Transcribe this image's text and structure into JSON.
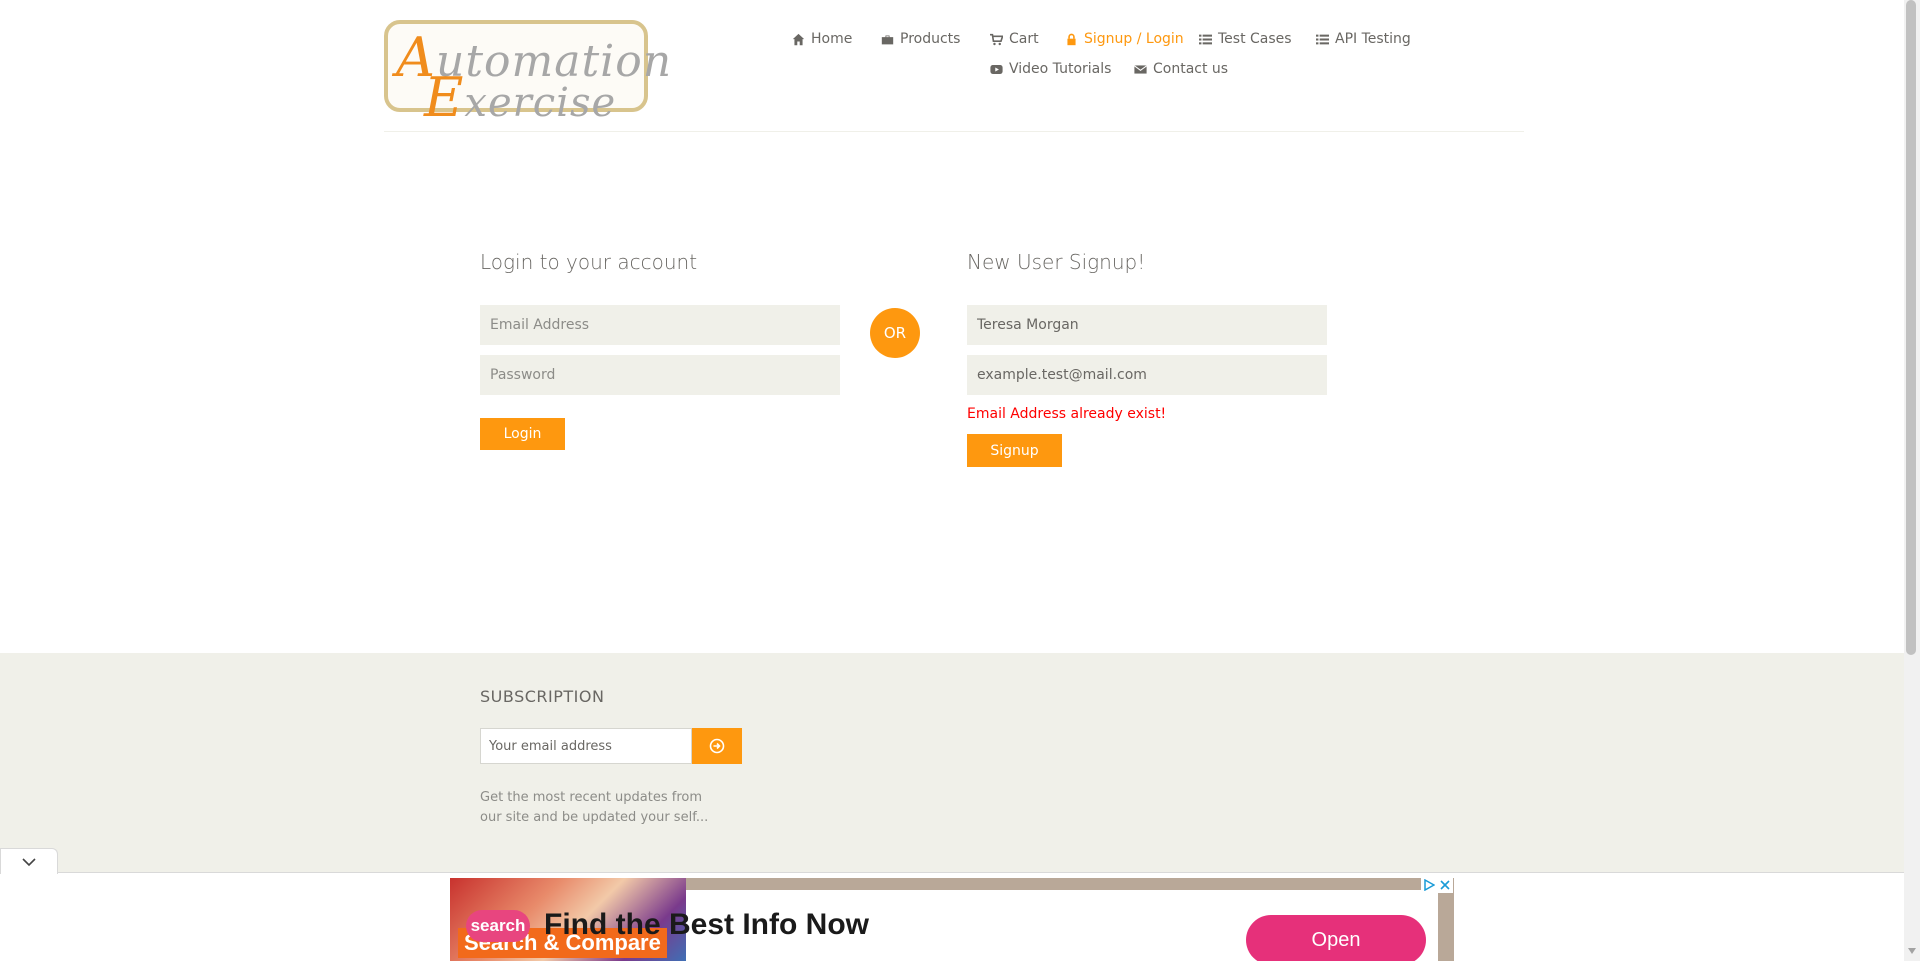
{
  "logo": {
    "line1": "utomation",
    "line1_cap": "A",
    "line2": "xercise",
    "line2_cap": "E"
  },
  "nav": [
    {
      "label": "Home",
      "icon": "home-icon"
    },
    {
      "label": "Products",
      "icon": "briefcase-icon"
    },
    {
      "label": "Cart",
      "icon": "cart-icon"
    },
    {
      "label": "Signup / Login",
      "icon": "lock-icon",
      "active": true
    },
    {
      "label": "Test Cases",
      "icon": "list-icon"
    },
    {
      "label": "API Testing",
      "icon": "list-icon"
    },
    {
      "label": "Video Tutorials",
      "icon": "youtube-icon"
    },
    {
      "label": "Contact us",
      "icon": "envelope-icon"
    }
  ],
  "login": {
    "title": "Login to your account",
    "email_placeholder": "Email Address",
    "password_placeholder": "Password",
    "button": "Login"
  },
  "or_label": "OR",
  "signup": {
    "title": "New User Signup!",
    "name_value": "Teresa Morgan",
    "email_value": "example.test@mail.com",
    "error": "Email Address already exist!",
    "button": "Signup"
  },
  "footer": {
    "subscription_title": "SUBSCRIPTION",
    "email_placeholder": "Your email address",
    "description": "Get the most recent updates from our site and be updated your self..."
  },
  "ad": {
    "image_text": "Search & Compare",
    "logo_text": "search",
    "headline": "Find the Best Info Now",
    "button": "Open"
  },
  "colors": {
    "accent": "#fe980f",
    "error": "#ff0000",
    "field_bg": "#f0f0e9",
    "text": "#696763",
    "ad_pink": "#e6307a"
  }
}
